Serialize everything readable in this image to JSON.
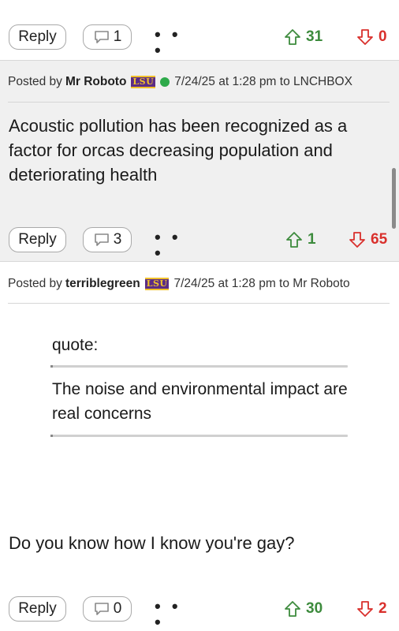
{
  "post1": {
    "reply_label": "Reply",
    "comment_count": "1",
    "more": "• • •",
    "upvotes": "31",
    "downvotes": "0"
  },
  "post2": {
    "posted_by": "Posted by",
    "author": "Mr Roboto",
    "badge": "LSU",
    "meta": "7/24/25 at 1:28 pm to LNCHBOX",
    "body": "Acoustic pollution has been recognized as a factor for orcas decreasing population and deteriorating health",
    "reply_label": "Reply",
    "comment_count": "3",
    "more": "• • •",
    "upvotes": "1",
    "downvotes": "65"
  },
  "post3": {
    "posted_by": "Posted by",
    "author": "terriblegreen",
    "badge": "LSU",
    "meta": "7/24/25 at 1:28 pm to Mr Roboto",
    "quote_label": "quote:",
    "quote_text": "The noise and environmental impact are real concerns",
    "body": "Do you know how I know you're gay?",
    "reply_label": "Reply",
    "comment_count": "0",
    "more": "• • •",
    "upvotes": "30",
    "downvotes": "2"
  },
  "colors": {
    "highlight_bg": "#f0f0f0",
    "upvote": "#3d8b3d",
    "downvote": "#d9302c",
    "online": "#2eaa4a",
    "badge_purple": "#5b2c86",
    "badge_gold": "#f0c02a"
  },
  "icons": [
    "comment-bubble-icon",
    "upvote-arrow-icon",
    "downvote-arrow-icon",
    "more-dots-icon"
  ]
}
